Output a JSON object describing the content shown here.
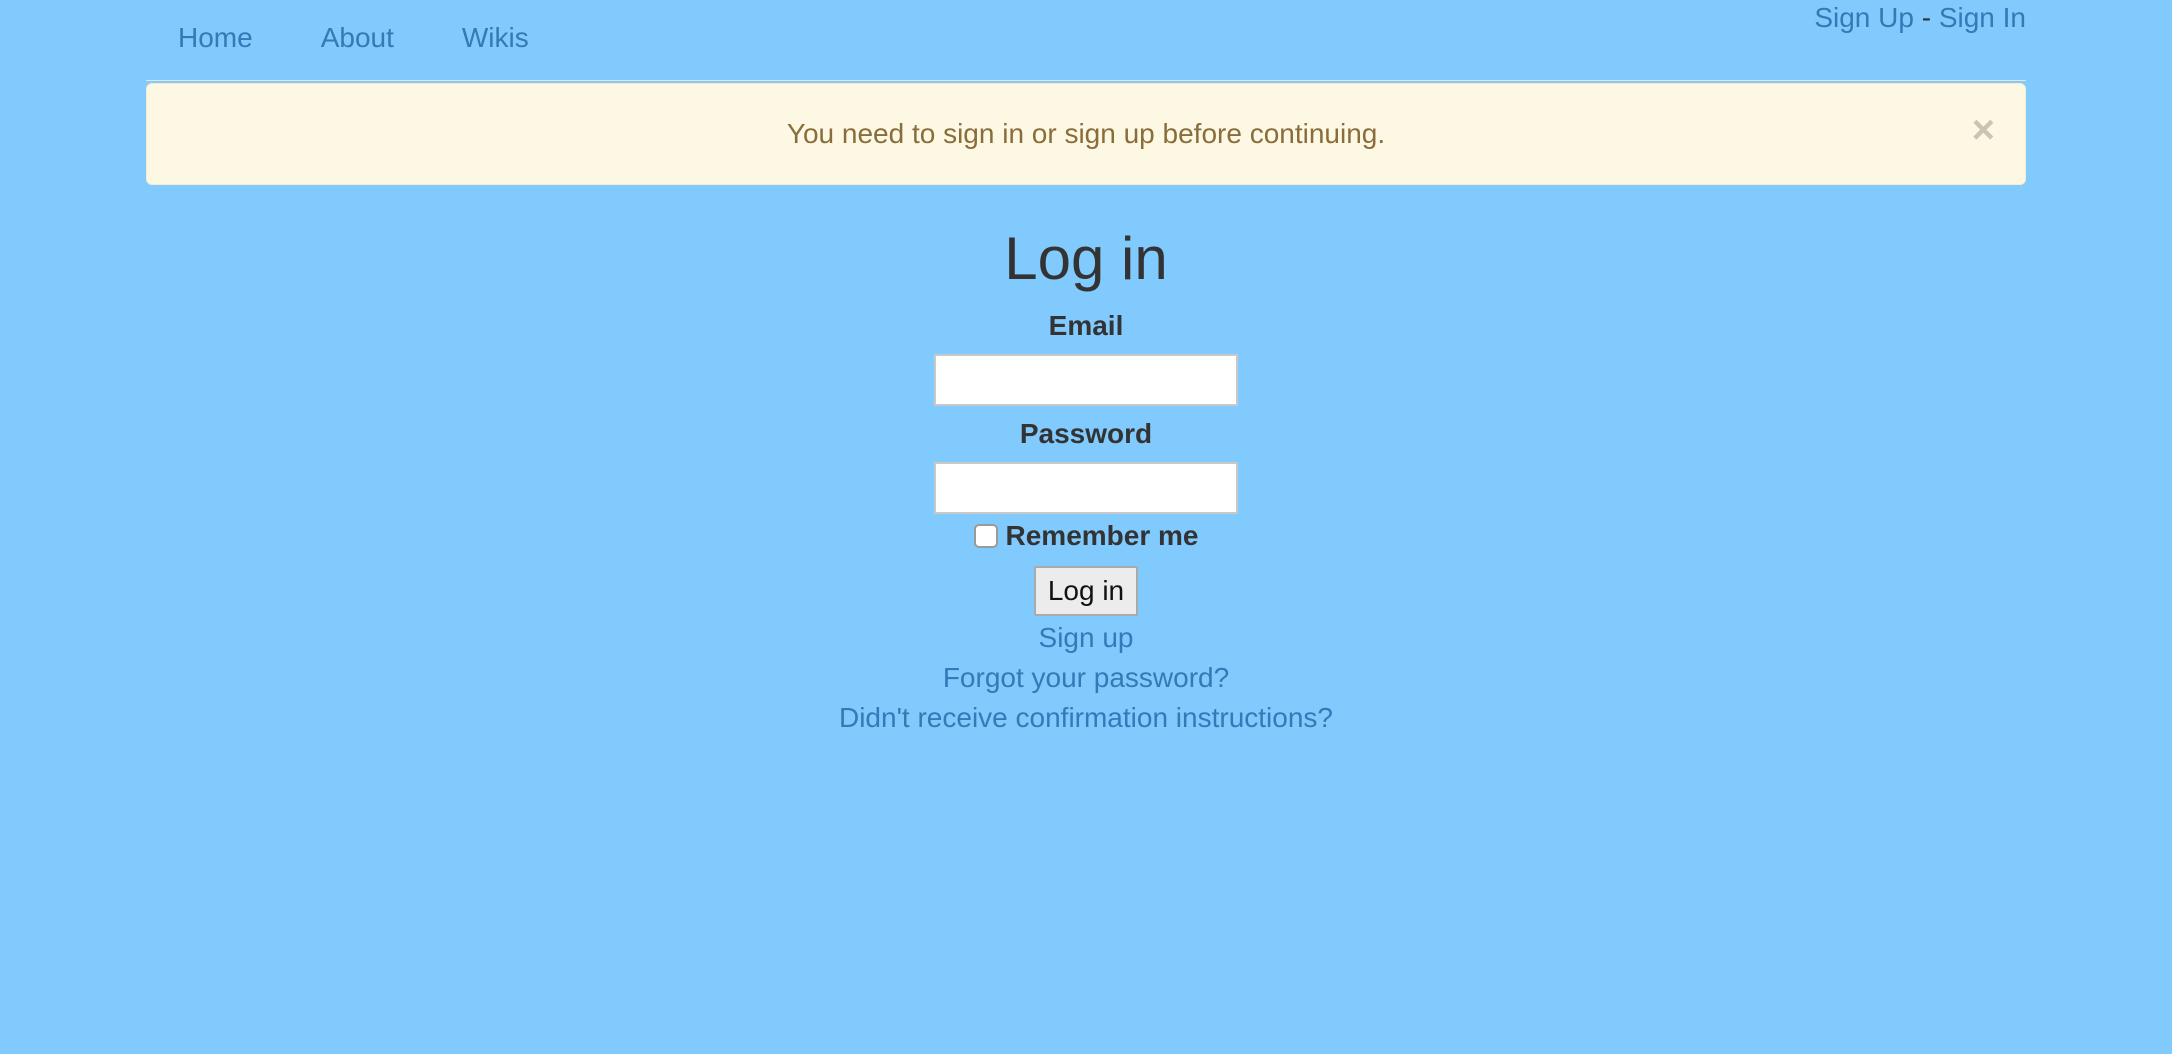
{
  "nav": {
    "home": "Home",
    "about": "About",
    "wikis": "Wikis",
    "sign_up": "Sign Up",
    "separator": " - ",
    "sign_in": "Sign In"
  },
  "alert": {
    "message": "You need to sign in or sign up before continuing.",
    "close": "×"
  },
  "login": {
    "title": "Log in",
    "email_label": "Email",
    "email_value": "",
    "password_label": "Password",
    "password_value": "",
    "remember_label": "Remember me",
    "remember_checked": false,
    "submit_label": "Log in",
    "links": {
      "sign_up": "Sign up",
      "forgot_password": "Forgot your password?",
      "confirmation": "Didn't receive confirmation instructions?"
    }
  },
  "colors": {
    "background": "#80cafe",
    "link": "#337ab7",
    "alert_bg": "#fcf8e3",
    "alert_text": "#8a6d3b"
  },
  "icons": {
    "alert_close": "close-icon"
  }
}
